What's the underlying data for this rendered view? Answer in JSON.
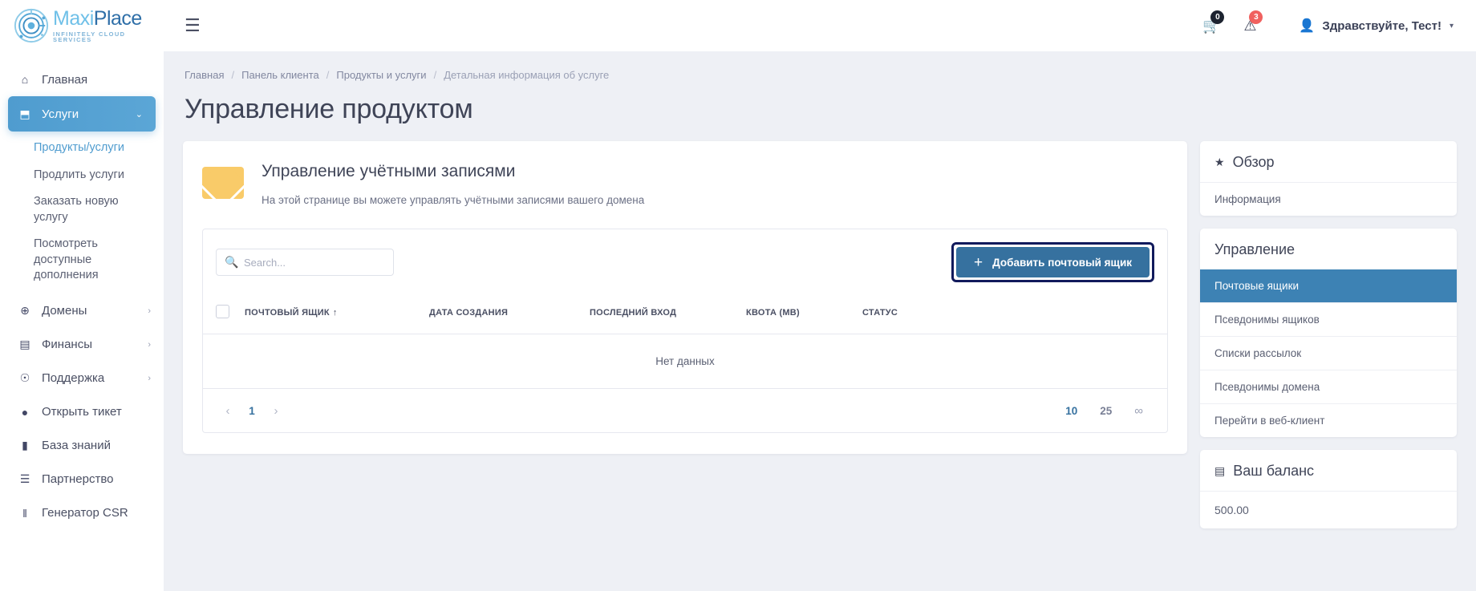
{
  "brand": {
    "name_part1": "Maxi",
    "name_part2": "Place",
    "tagline": "INFINITELY CLOUD SERVICES"
  },
  "sidebar": {
    "items": [
      {
        "label": "Главная",
        "icon": "home-icon",
        "glyph": "⌂",
        "active": false,
        "chevron": ""
      },
      {
        "label": "Услуги",
        "icon": "box-icon",
        "glyph": "⬒",
        "active": true,
        "chevron": "⌄"
      },
      {
        "label": "Домены",
        "icon": "globe-icon",
        "glyph": "⊕",
        "active": false,
        "chevron": "›"
      },
      {
        "label": "Финансы",
        "icon": "invoice-icon",
        "glyph": "▤",
        "active": false,
        "chevron": "›"
      },
      {
        "label": "Поддержка",
        "icon": "lifebuoy-icon",
        "glyph": "☉",
        "active": false,
        "chevron": "›"
      },
      {
        "label": "Открыть тикет",
        "icon": "chat-icon",
        "glyph": "●",
        "active": false,
        "chevron": ""
      },
      {
        "label": "База знаний",
        "icon": "document-icon",
        "glyph": "▮",
        "active": false,
        "chevron": ""
      },
      {
        "label": "Партнерство",
        "icon": "users-icon",
        "glyph": "☰",
        "active": false,
        "chevron": ""
      },
      {
        "label": "Генератор CSR",
        "icon": "barcode-icon",
        "glyph": "‖",
        "active": false,
        "chevron": ""
      }
    ],
    "subitems": [
      {
        "label": "Продукты/услуги",
        "current": true
      },
      {
        "label": "Продлить услуги",
        "current": false
      },
      {
        "label": "Заказать новую услугу",
        "current": false
      },
      {
        "label": "Посмотреть доступные дополнения",
        "current": false
      }
    ]
  },
  "topbar": {
    "menu_toggle": "☰",
    "cart": {
      "icon": "cart-icon",
      "glyph": "🛒",
      "count": "0"
    },
    "alerts": {
      "icon": "warning-icon",
      "glyph": "⚠",
      "count": "3"
    },
    "user": {
      "avatar_icon": "user-icon",
      "greeting": "Здравствуйте, Тест!",
      "caret": "▾"
    }
  },
  "breadcrumb": [
    "Главная",
    "Панель клиента",
    "Продукты и услуги",
    "Детальная информация об услуге"
  ],
  "page": {
    "title": "Управление продуктом"
  },
  "product_card": {
    "icon": "envelope-icon",
    "title": "Управление учётными записями",
    "description": "На этой странице вы можете управлять учётными записями вашего домена"
  },
  "table": {
    "search_placeholder": "Search...",
    "search_value": "",
    "search_icon": "search-icon",
    "add_button": {
      "label": "Добавить почтовый ящик",
      "plus": "+",
      "focused": true
    },
    "columns": [
      {
        "label": "ПОЧТОВЫЙ ЯЩИК",
        "sorted": true,
        "sort_arrow": "↑"
      },
      {
        "label": "ДАТА СОЗДАНИЯ",
        "sorted": false,
        "sort_arrow": ""
      },
      {
        "label": "ПОСЛЕДНИЙ ВХОД",
        "sorted": false,
        "sort_arrow": ""
      },
      {
        "label": "КВОТА (MB)",
        "sorted": false,
        "sort_arrow": ""
      },
      {
        "label": "СТАТУС",
        "sorted": false,
        "sort_arrow": ""
      }
    ],
    "rows": [],
    "empty_text": "Нет данных",
    "pagination": {
      "prev": "‹",
      "next": "›",
      "current_page": "1",
      "sizes": [
        {
          "label": "10",
          "active": true
        },
        {
          "label": "25",
          "active": false
        },
        {
          "label": "∞",
          "active": false
        }
      ]
    }
  },
  "right": {
    "overview": {
      "icon": "star-icon",
      "glyph": "★",
      "title": "Обзор",
      "rows": [
        {
          "label": "Информация",
          "selected": false
        }
      ]
    },
    "management": {
      "title": "Управление",
      "rows": [
        {
          "label": "Почтовые ящики",
          "selected": true
        },
        {
          "label": "Псевдонимы ящиков",
          "selected": false
        },
        {
          "label": "Списки рассылок",
          "selected": false
        },
        {
          "label": "Псевдонимы домена",
          "selected": false
        },
        {
          "label": "Перейти в веб-клиент",
          "selected": false
        }
      ]
    },
    "balance": {
      "icon": "card-icon",
      "glyph": "▤",
      "title": "Ваш баланс",
      "amount": "500.00"
    }
  },
  "colors": {
    "accent_blue": "#4f9ccf",
    "panel_selected": "#3d82b4",
    "button_blue": "#36719f",
    "focus_ring": "#111a5c",
    "badge_red": "#f0615f",
    "badge_dark": "#1d2330",
    "envelope_yellow": "#f9cb69"
  }
}
